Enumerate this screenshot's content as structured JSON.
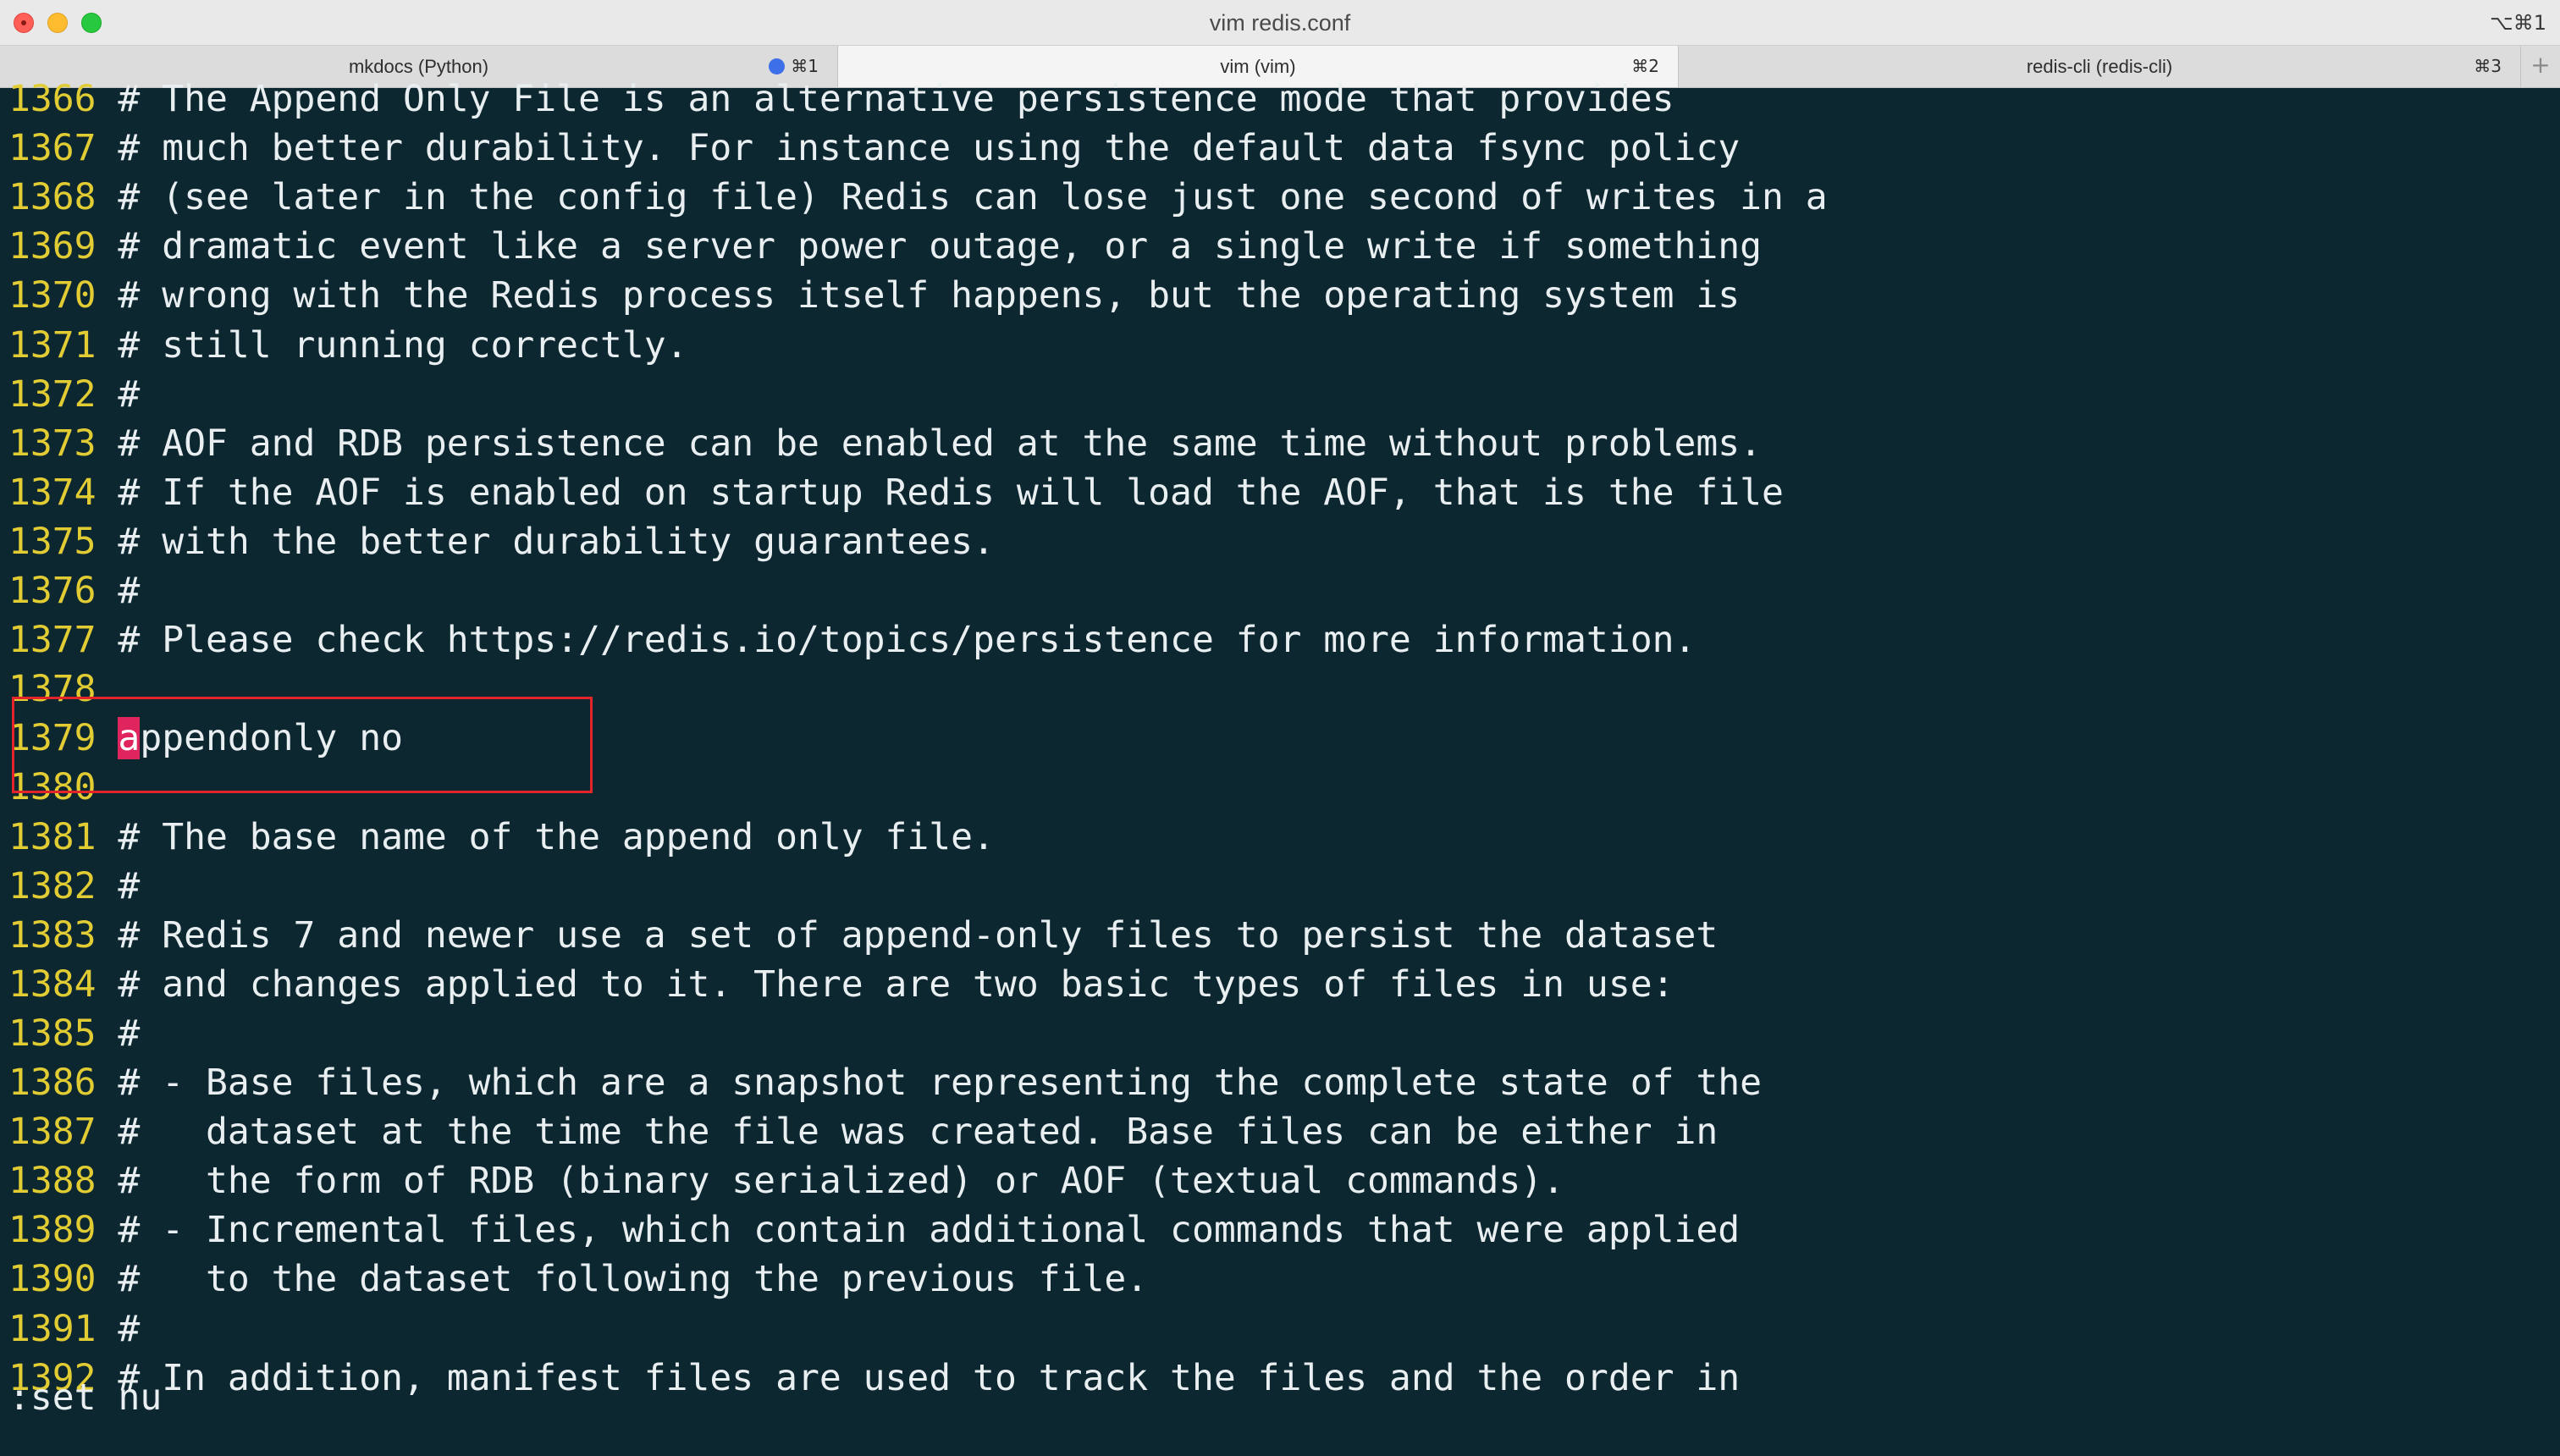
{
  "window": {
    "title": "vim redis.conf",
    "shortcut": "⌥⌘1"
  },
  "tabs": [
    {
      "label": "mkdocs (Python)",
      "shortcut": "⌘1",
      "has_activity_dot": true,
      "active": false
    },
    {
      "label": "vim (vim)",
      "shortcut": "⌘2",
      "has_activity_dot": false,
      "active": true
    },
    {
      "label": "redis-cli (redis-cli)",
      "shortcut": "⌘3",
      "has_activity_dot": false,
      "active": false
    }
  ],
  "new_tab_label": "+",
  "editor": {
    "lines": [
      {
        "num": "1366",
        "text": "# The Append Only File is an alternative persistence mode that provides"
      },
      {
        "num": "1367",
        "text": "# much better durability. For instance using the default data fsync policy"
      },
      {
        "num": "1368",
        "text": "# (see later in the config file) Redis can lose just one second of writes in a"
      },
      {
        "num": "1369",
        "text": "# dramatic event like a server power outage, or a single write if something"
      },
      {
        "num": "1370",
        "text": "# wrong with the Redis process itself happens, but the operating system is"
      },
      {
        "num": "1371",
        "text": "# still running correctly."
      },
      {
        "num": "1372",
        "text": "#"
      },
      {
        "num": "1373",
        "text": "# AOF and RDB persistence can be enabled at the same time without problems."
      },
      {
        "num": "1374",
        "text": "# If the AOF is enabled on startup Redis will load the AOF, that is the file"
      },
      {
        "num": "1375",
        "text": "# with the better durability guarantees."
      },
      {
        "num": "1376",
        "text": "#"
      },
      {
        "num": "1377",
        "text": "# Please check https://redis.io/topics/persistence for more information."
      },
      {
        "num": "1378",
        "text": ""
      },
      {
        "num": "1379",
        "text": "appendonly no"
      },
      {
        "num": "1380",
        "text": ""
      },
      {
        "num": "1381",
        "text": "# The base name of the append only file."
      },
      {
        "num": "1382",
        "text": "#"
      },
      {
        "num": "1383",
        "text": "# Redis 7 and newer use a set of append-only files to persist the dataset"
      },
      {
        "num": "1384",
        "text": "# and changes applied to it. There are two basic types of files in use:"
      },
      {
        "num": "1385",
        "text": "#"
      },
      {
        "num": "1386",
        "text": "# - Base files, which are a snapshot representing the complete state of the"
      },
      {
        "num": "1387",
        "text": "#   dataset at the time the file was created. Base files can be either in"
      },
      {
        "num": "1388",
        "text": "#   the form of RDB (binary serialized) or AOF (textual commands)."
      },
      {
        "num": "1389",
        "text": "# - Incremental files, which contain additional commands that were applied"
      },
      {
        "num": "1390",
        "text": "#   to the dataset following the previous file."
      },
      {
        "num": "1391",
        "text": "#"
      },
      {
        "num": "1392",
        "text": "# In addition, manifest files are used to track the files and the order in"
      }
    ],
    "cursor_line_index": 13,
    "cursor_column": 0,
    "highlighted_line_indices": [
      13,
      14
    ],
    "command_line": ":set nu"
  },
  "colors": {
    "background": "#0d2731",
    "text": "#e9eff1",
    "line_number": "#e2cc33",
    "cursor": "#e0245e",
    "highlight_box": "#e3242b",
    "tab_activity_dot": "#3d6fe8"
  },
  "icons": {
    "close": "close-button",
    "minimize": "minimize-button",
    "maximize": "zoom-button",
    "activity": "activity-dot-icon",
    "new_tab": "plus-icon"
  }
}
